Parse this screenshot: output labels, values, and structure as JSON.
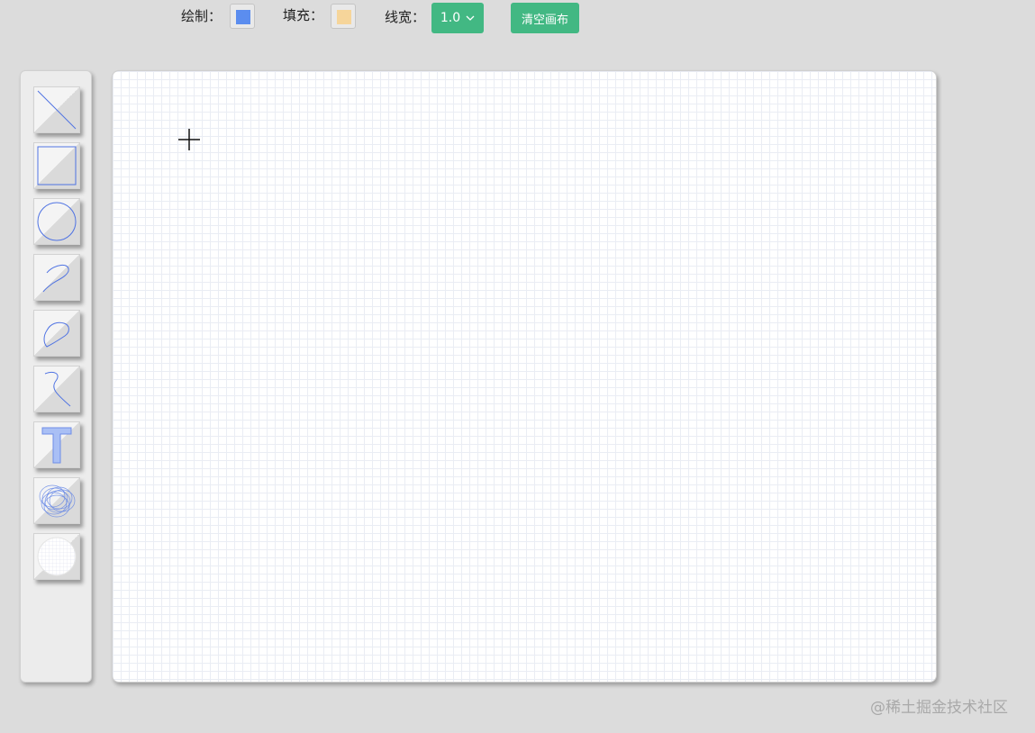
{
  "toolbar": {
    "stroke_label": "绘制：",
    "stroke_color": "#5b8def",
    "fill_label": "填充：",
    "fill_color": "#f6d59a",
    "line_width_label": "线宽：",
    "line_width_value": "1.0",
    "clear_label": "清空画布",
    "accent_color": "#42b883"
  },
  "tools": [
    {
      "name": "line-tool",
      "icon": "line-icon"
    },
    {
      "name": "rectangle-tool",
      "icon": "rectangle-icon"
    },
    {
      "name": "circle-tool",
      "icon": "circle-icon"
    },
    {
      "name": "pencil-tool",
      "icon": "freehand-curve-icon"
    },
    {
      "name": "polygon-tool",
      "icon": "closed-curve-icon"
    },
    {
      "name": "bezier-tool",
      "icon": "bezier-curve-icon"
    },
    {
      "name": "text-tool",
      "icon": "text-icon",
      "glyph": "T"
    },
    {
      "name": "spirograph-tool",
      "icon": "spirograph-icon"
    },
    {
      "name": "eraser-tool",
      "icon": "eraser-grid-icon"
    }
  ],
  "watermark": "@稀土掘金技术社区"
}
